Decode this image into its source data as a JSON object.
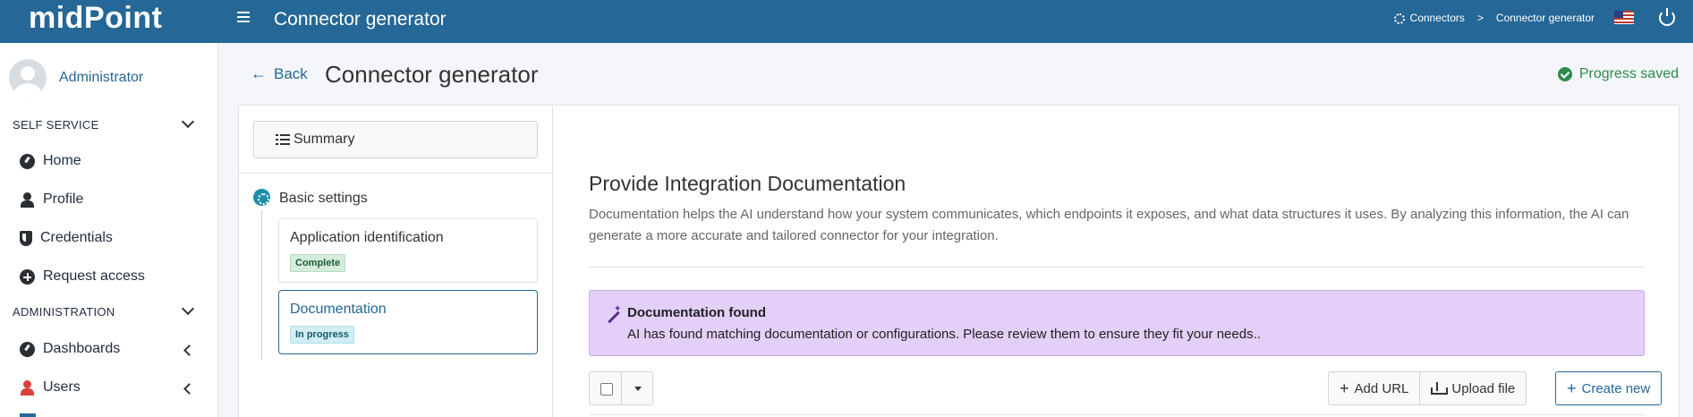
{
  "topbar": {
    "logo": "midPoint",
    "title": "Connector generator",
    "breadcrumbs": [
      "Connectors",
      "Connector generator"
    ],
    "breadcrumb_separator": ">"
  },
  "sidebar": {
    "user_name": "Administrator",
    "sections": [
      {
        "label": "SELF SERVICE",
        "items": [
          {
            "label": "Home",
            "icon": "dashboard-icon"
          },
          {
            "label": "Profile",
            "icon": "person-icon"
          },
          {
            "label": "Credentials",
            "icon": "shield-icon"
          },
          {
            "label": "Request access",
            "icon": "plus-circle-icon"
          }
        ]
      },
      {
        "label": "ADMINISTRATION",
        "items": [
          {
            "label": "Dashboards",
            "icon": "dashboard-icon"
          },
          {
            "label": "Users",
            "icon": "person-icon"
          }
        ]
      }
    ]
  },
  "header": {
    "back_label": "Back",
    "page_title": "Connector generator",
    "status": "Progress saved"
  },
  "wizard": {
    "summary_label": "Summary",
    "group_label": "Basic settings",
    "steps": [
      {
        "title": "Application identification",
        "badge": "Complete"
      },
      {
        "title": "Documentation",
        "badge": "In progress"
      }
    ]
  },
  "main": {
    "heading": "Provide Integration Documentation",
    "description": "Documentation helps the AI understand how your system communicates, which endpoints it exposes, and what data structures it uses. By analyzing this information, the AI can generate a more accurate and tailored connector for your integration.",
    "alert": {
      "title": "Documentation found",
      "text": "AI has found matching documentation or configurations. Please review them to ensure they fit your needs.."
    },
    "toolbar": {
      "add_url": "Add URL",
      "upload_file": "Upload file",
      "create_new": "Create new"
    }
  },
  "colors": {
    "topbar": "#256796",
    "accent": "#256796",
    "success": "#2e8a4a",
    "alert_bg": "#e3cff8"
  }
}
